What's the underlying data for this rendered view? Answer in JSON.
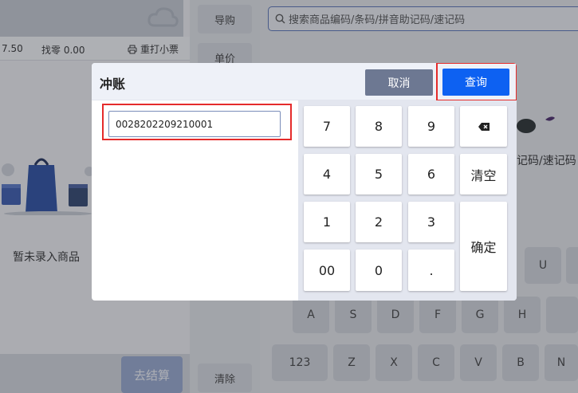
{
  "left": {
    "paid": "7.50",
    "change_label": "找零 0.00",
    "reprint_label": "重打小票",
    "empty_text": "暂未录入商品",
    "checkout_label": "去结算"
  },
  "mid": {
    "guide_label": "导购",
    "price_label": "单价",
    "clear_label": "清除"
  },
  "search": {
    "placeholder": "搜索商品编码/条码/拼音助记码/速记码"
  },
  "background_hint": "记码/速记码",
  "keyboard": {
    "row1": [
      "U"
    ],
    "row2": [
      "A",
      "S",
      "D",
      "F",
      "G",
      "H"
    ],
    "row3": [
      "123",
      "Z",
      "X",
      "C",
      "V",
      "B",
      "N"
    ]
  },
  "dialog": {
    "title": "冲账",
    "cancel_label": "取消",
    "query_label": "查询",
    "input_value": "0028202209210001",
    "keys": {
      "k7": "7",
      "k8": "8",
      "k9": "9",
      "k4": "4",
      "k5": "5",
      "k6": "6",
      "k1": "1",
      "k2": "2",
      "k3": "3",
      "k00": "00",
      "k0": "0",
      "kdot": ".",
      "clear": "清空",
      "confirm": "确定"
    }
  },
  "colors": {
    "primary": "#0d61f2",
    "cancel": "#6d7892",
    "highlight": "#e52b2b"
  }
}
